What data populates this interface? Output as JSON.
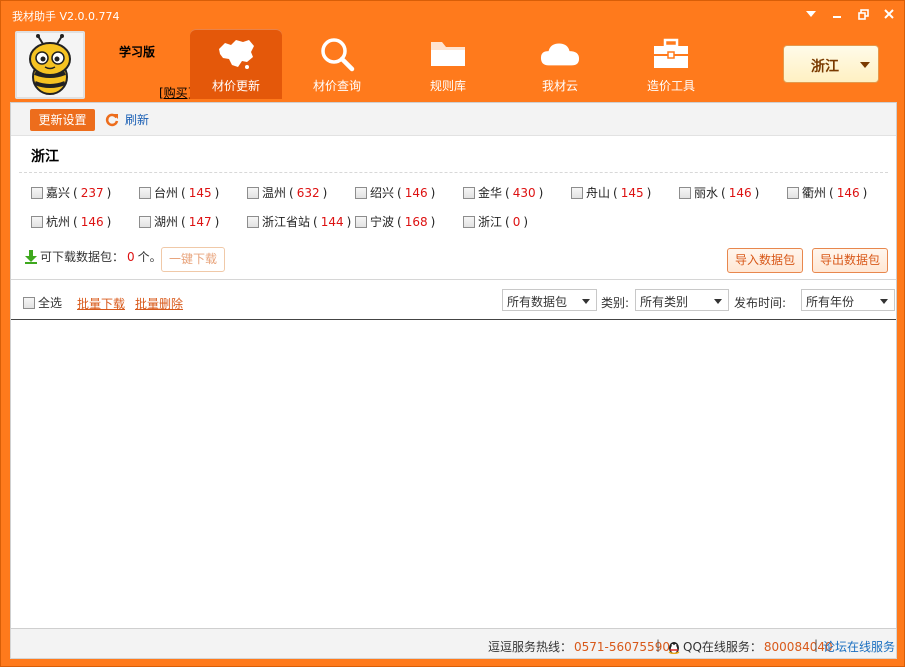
{
  "app": {
    "title": "我材助手  V2.0.0.774"
  },
  "account": {
    "edition": "学习版",
    "buy_label": "[购买]"
  },
  "nav": [
    {
      "label": "材价更新",
      "icon": "china-map-icon",
      "active": true
    },
    {
      "label": "材价查询",
      "icon": "magnifier-icon",
      "active": false
    },
    {
      "label": "规则库",
      "icon": "folder-icon",
      "active": false
    },
    {
      "label": "我材云",
      "icon": "cloud-icon",
      "active": false
    },
    {
      "label": "造价工具",
      "icon": "toolbox-icon",
      "active": false
    }
  ],
  "region_selector": {
    "value": "浙江"
  },
  "toolbar": {
    "update_settings": "更新设置",
    "refresh": "刷新"
  },
  "region_title": "浙江",
  "cities": [
    {
      "name": "嘉兴",
      "count": "237"
    },
    {
      "name": "台州",
      "count": "145"
    },
    {
      "name": "温州",
      "count": "632"
    },
    {
      "name": "绍兴",
      "count": "146"
    },
    {
      "name": "金华",
      "count": "430"
    },
    {
      "name": "舟山",
      "count": "145"
    },
    {
      "name": "丽水",
      "count": "146"
    },
    {
      "name": "衢州",
      "count": "146"
    },
    {
      "name": "杭州",
      "count": "146"
    },
    {
      "name": "湖州",
      "count": "147"
    },
    {
      "name": "浙江省站",
      "count": "144"
    },
    {
      "name": "宁波",
      "count": "168"
    },
    {
      "name": "浙江",
      "count": "0"
    }
  ],
  "download": {
    "label": "可下载数据包：",
    "count": "0",
    "unit": " 个。",
    "onekey": "一键下载"
  },
  "package_buttons": {
    "import": "导入数据包",
    "export": "导出数据包"
  },
  "filters": {
    "select_all": "全选",
    "batch_download": "批量下载",
    "batch_delete": "批量删除",
    "package_select": "所有数据包",
    "category_label": "类别:",
    "category_select": "所有类别",
    "date_label": "发布时间:",
    "date_select": "所有年份"
  },
  "status": {
    "hotline_label": "逗逗服务热线：",
    "hotline": "0571-56075590",
    "qq_label": "QQ在线服务：",
    "qq": "800084040",
    "forum": "论坛在线服务",
    "sep": "|"
  },
  "colors": {
    "brand_orange": "#ff7a1c",
    "active_tab": "#e4580a",
    "count_red": "#dd1111",
    "link_blue": "#1a6fc0"
  }
}
